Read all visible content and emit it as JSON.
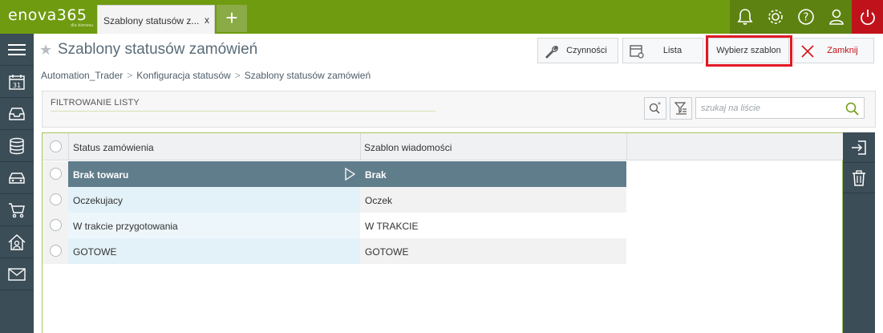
{
  "app": {
    "logo_text": "enova365",
    "logo_subtext": "dla biznesu",
    "tab_title": "Szablony statusów z...",
    "tab_close": "x",
    "tab_add": "+"
  },
  "topbar_icons": [
    "bell-icon",
    "gear-icon",
    "help-icon",
    "user-icon",
    "power-icon"
  ],
  "sidebar_icons": [
    "menu-icon",
    "calendar-icon",
    "inbox-icon",
    "database-icon",
    "car-icon",
    "cart-icon",
    "house-user-icon",
    "mail-icon"
  ],
  "calendar_day": "31",
  "page": {
    "title": "Szablony statusów zamówień"
  },
  "toolbar": {
    "czynnosci": "Czynności",
    "lista": "Lista",
    "wybierz_szablon": "Wybierz szablon",
    "zamknij": "Zamknij"
  },
  "breadcrumb": [
    "Automation_Trader",
    "Konfiguracja statusów",
    "Szablony statusów zamówień"
  ],
  "filter": {
    "label": "FILTROWANIE LISTY",
    "search_placeholder": "szukaj na liście"
  },
  "grid": {
    "columns": [
      "Status zamówienia",
      "Szablon wiadomości"
    ],
    "rows": [
      {
        "status": "Brak towaru",
        "template": "Brak",
        "selected": true
      },
      {
        "status": "Oczekujacy",
        "template": "Oczek",
        "selected": false
      },
      {
        "status": "W trakcie przygotowania",
        "template": "W TRAKCIE",
        "selected": false
      },
      {
        "status": "GOTOWE",
        "template": "GOTOWE",
        "selected": false
      }
    ]
  },
  "right_actions": [
    "sign-in-icon",
    "trash-icon"
  ],
  "colors": {
    "topbar": "#6f9b10",
    "sidebar": "#3b4d57",
    "selected_row": "#607d8b",
    "highlight_border": "#e01a25",
    "close_red": "#c0121b"
  }
}
